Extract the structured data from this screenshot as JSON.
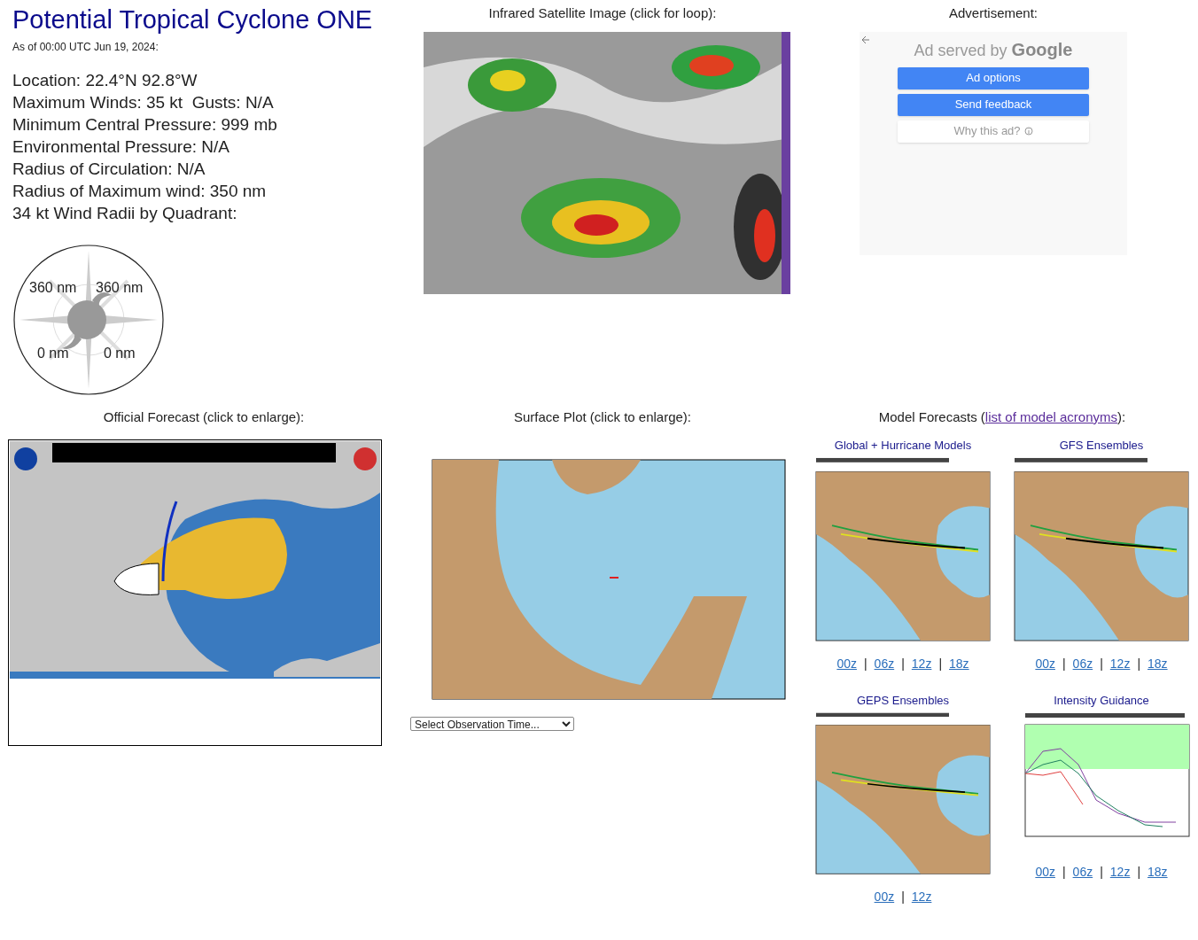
{
  "title": "Potential Tropical Cyclone ONE",
  "as_of": "As of 00:00 UTC Jun 19, 2024:",
  "details": [
    "Location: 22.4°N 92.8°W",
    "Maximum Winds: 35 kt  Gusts: N/A",
    "Minimum Central Pressure: 999 mb",
    "Environmental Pressure: N/A",
    "Radius of Circulation: N/A",
    "Radius of Maximum wind: 350 nm",
    "34 kt Wind Radii by Quadrant:"
  ],
  "wind_radii": {
    "nw": "360 nm",
    "ne": "360 nm",
    "sw": "0 nm",
    "se": "0 nm"
  },
  "satellite": {
    "heading": "Infrared Satellite Image (click for loop):"
  },
  "advertisement": {
    "heading": "Advertisement:",
    "served_by": "Ad served by",
    "brand": "Google",
    "buttons": [
      {
        "label": "Ad options",
        "kind": "primary"
      },
      {
        "label": "Send feedback",
        "kind": "primary"
      },
      {
        "label": "Why this ad?",
        "kind": "secondary"
      }
    ]
  },
  "official_forecast": {
    "heading": "Official Forecast (click to enlarge):"
  },
  "surface_plot": {
    "heading": "Surface Plot (click to enlarge):",
    "select": "Select Observation Time..."
  },
  "model_forecasts": {
    "heading_before": "Model Forecasts (",
    "link": "list of model acronyms",
    "heading_after": "):",
    "panels": [
      {
        "title": "Global + Hurricane Models",
        "kind": "track_map",
        "separator": "|",
        "runs": [
          "00z",
          "06z",
          "12z",
          "18z"
        ]
      },
      {
        "title": "GFS Ensembles",
        "kind": "track_map",
        "separator": "|",
        "runs": [
          "00z",
          "06z",
          "12z",
          "18z"
        ]
      },
      {
        "title": "GEPS Ensembles",
        "kind": "track_map",
        "separator": "|",
        "runs": [
          "00z",
          "12z"
        ]
      },
      {
        "title": "Intensity Guidance",
        "kind": "intensity",
        "separator": "|",
        "runs": [
          "00z",
          "06z",
          "12z",
          "18z"
        ]
      }
    ]
  }
}
